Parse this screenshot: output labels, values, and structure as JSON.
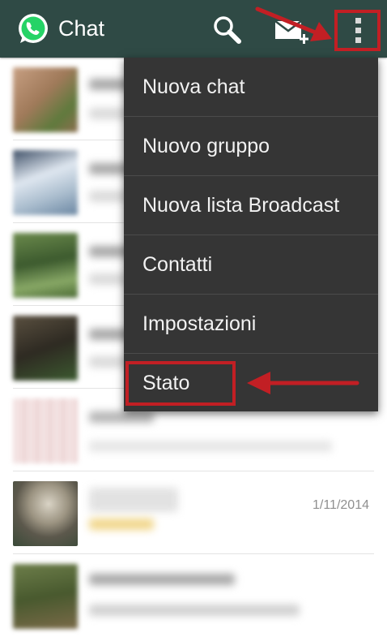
{
  "app": {
    "title": "Chat"
  },
  "icons": {
    "logo": "whatsapp-logo-icon",
    "search": "search-icon",
    "new_chat": "new-chat-icon",
    "overflow": "overflow-menu-icon"
  },
  "menu": {
    "items": [
      {
        "label": "Nuova chat"
      },
      {
        "label": "Nuovo gruppo"
      },
      {
        "label": "Nuova lista Broadcast"
      },
      {
        "label": "Contatti"
      },
      {
        "label": "Impostazioni"
      },
      {
        "label": "Stato"
      }
    ]
  },
  "chats": [
    {
      "date": ""
    },
    {
      "date": ""
    },
    {
      "date": ""
    },
    {
      "date": ""
    },
    {
      "date": ""
    },
    {
      "date": "1/11/2014"
    },
    {
      "date": ""
    }
  ],
  "colors": {
    "actionbar": "#2f4a45",
    "menu_bg": "#353535",
    "annotation": "#c21f24"
  }
}
